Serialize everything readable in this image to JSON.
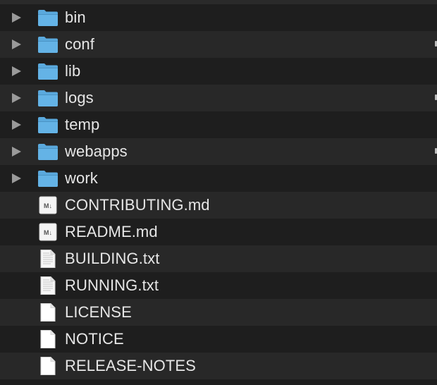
{
  "files": [
    {
      "name": "bin",
      "kind": "folder",
      "expandable": true,
      "icon": "folder-icon"
    },
    {
      "name": "conf",
      "kind": "folder",
      "expandable": true,
      "icon": "folder-icon"
    },
    {
      "name": "lib",
      "kind": "folder",
      "expandable": true,
      "icon": "folder-icon"
    },
    {
      "name": "logs",
      "kind": "folder",
      "expandable": true,
      "icon": "folder-icon"
    },
    {
      "name": "temp",
      "kind": "folder",
      "expandable": true,
      "icon": "folder-icon"
    },
    {
      "name": "webapps",
      "kind": "folder",
      "expandable": true,
      "icon": "folder-icon"
    },
    {
      "name": "work",
      "kind": "folder",
      "expandable": true,
      "icon": "folder-icon"
    },
    {
      "name": "CONTRIBUTING.md",
      "kind": "markdown",
      "expandable": false,
      "icon": "markdown-file-icon"
    },
    {
      "name": "README.md",
      "kind": "markdown",
      "expandable": false,
      "icon": "markdown-file-icon"
    },
    {
      "name": "BUILDING.txt",
      "kind": "text",
      "expandable": false,
      "icon": "text-file-icon"
    },
    {
      "name": "RUNNING.txt",
      "kind": "text",
      "expandable": false,
      "icon": "text-file-icon"
    },
    {
      "name": "LICENSE",
      "kind": "blank",
      "expandable": false,
      "icon": "blank-file-icon"
    },
    {
      "name": "NOTICE",
      "kind": "blank",
      "expandable": false,
      "icon": "blank-file-icon"
    },
    {
      "name": "RELEASE-NOTES",
      "kind": "blank",
      "expandable": false,
      "icon": "blank-file-icon"
    }
  ],
  "colors": {
    "background": "#1e1e1e",
    "alt_row": "#282828",
    "text": "#e6e6e6",
    "folder": "#5aa9dd",
    "disclosure": "#9a9a9a"
  }
}
